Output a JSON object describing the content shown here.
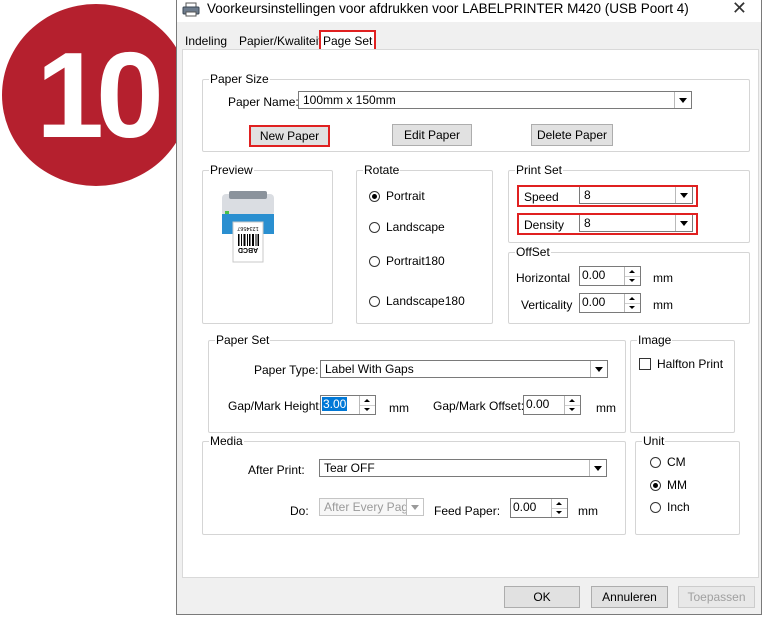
{
  "step_badge": "10",
  "window": {
    "title": "Voorkeursinstellingen voor afdrukken voor LABELPRINTER M420 (USB Poort 4)",
    "close_glyph": "✕"
  },
  "tabs": [
    {
      "label": "Indeling"
    },
    {
      "label": "Papier/Kwaliteit"
    },
    {
      "label": "Page Set"
    }
  ],
  "paper_size": {
    "legend": "Paper Size",
    "name_label": "Paper Name:",
    "name_value": "100mm x 150mm",
    "new_btn": "New Paper",
    "edit_btn": "Edit Paper",
    "delete_btn": "Delete Paper"
  },
  "preview": {
    "legend": "Preview",
    "label_text_1": "1234567",
    "label_text_2": "ABCD"
  },
  "rotate": {
    "legend": "Rotate",
    "options": [
      {
        "label": "Portrait",
        "selected": true
      },
      {
        "label": "Landscape",
        "selected": false
      },
      {
        "label": "Portrait180",
        "selected": false
      },
      {
        "label": "Landscape180",
        "selected": false
      }
    ]
  },
  "print_set": {
    "legend": "Print Set",
    "speed_label": "Speed",
    "speed_value": "8",
    "density_label": "Density",
    "density_value": "8"
  },
  "offset": {
    "legend": "OffSet",
    "horizontal_label": "Horizontal",
    "horizontal_value": "0.00",
    "verticality_label": "Verticality",
    "verticality_value": "0.00",
    "unit": "mm"
  },
  "paper_set": {
    "legend": "Paper Set",
    "type_label": "Paper Type:",
    "type_value": "Label With Gaps",
    "gap_height_label": "Gap/Mark Height:",
    "gap_height_value": "3.00",
    "gap_offset_label": "Gap/Mark Offset:",
    "gap_offset_value": "0.00",
    "unit": "mm"
  },
  "image": {
    "legend": "Image",
    "halftone_label": "Halfton Print",
    "halftone_checked": false
  },
  "media": {
    "legend": "Media",
    "after_print_label": "After Print:",
    "after_print_value": "Tear OFF",
    "do_label": "Do:",
    "do_value": "After Every Page",
    "feed_label": "Feed Paper:",
    "feed_value": "0.00",
    "unit": "mm"
  },
  "unit": {
    "legend": "Unit",
    "options": [
      {
        "label": "CM",
        "selected": false
      },
      {
        "label": "MM",
        "selected": true
      },
      {
        "label": "Inch",
        "selected": false
      }
    ]
  },
  "footer": {
    "ok": "OK",
    "cancel": "Annuleren",
    "apply": "Toepassen"
  },
  "colors": {
    "badge": "#b5202e",
    "highlight": "#e02020",
    "selection": "#0078d7"
  }
}
